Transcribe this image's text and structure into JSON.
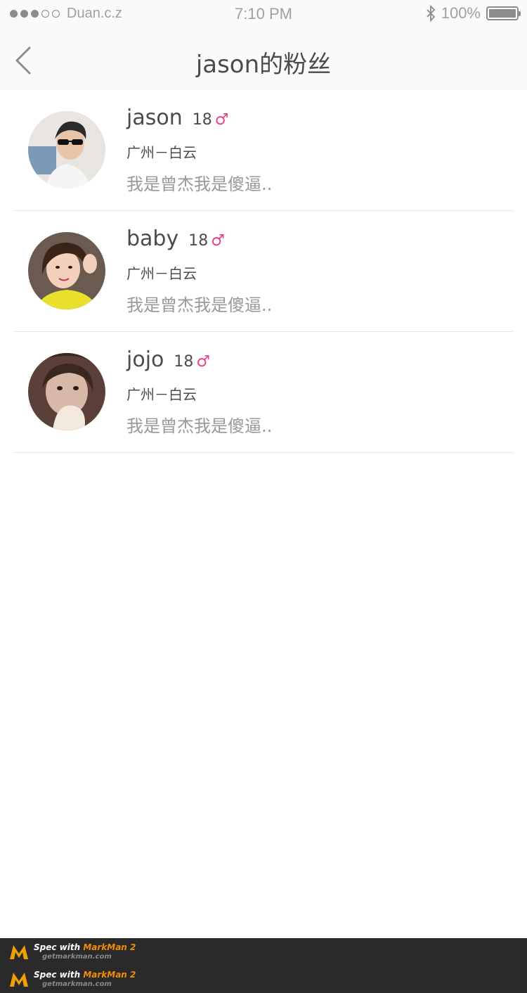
{
  "status_bar": {
    "carrier": "Duan.c.z",
    "time": "7:10 PM",
    "battery": "100%",
    "signal_dots_filled": 3,
    "signal_dots_total": 5
  },
  "nav": {
    "title": "jason的粉丝",
    "back_icon": "chevron-left-icon"
  },
  "fans": [
    {
      "name": "jason",
      "age": "18",
      "gender_symbol": "♂",
      "location": "广州－白云",
      "bio": "我是曾杰我是傻逼.."
    },
    {
      "name": "baby",
      "age": "18",
      "gender_symbol": "♂",
      "location": "广州－白云",
      "bio": "我是曾杰我是傻逼.."
    },
    {
      "name": "jojo",
      "age": "18",
      "gender_symbol": "♂",
      "location": "广州－白云",
      "bio": "我是曾杰我是傻逼.."
    }
  ],
  "footer": {
    "line1_prefix": "Spec with ",
    "line1_brand": "MarkMan 2",
    "line2": "getmarkman.com"
  },
  "colors": {
    "nav_bg": "#fafafa",
    "text_primary": "#4c4c4c",
    "text_secondary": "#999999",
    "gender": "#e83e8c",
    "page_bg": "#ffffff"
  }
}
